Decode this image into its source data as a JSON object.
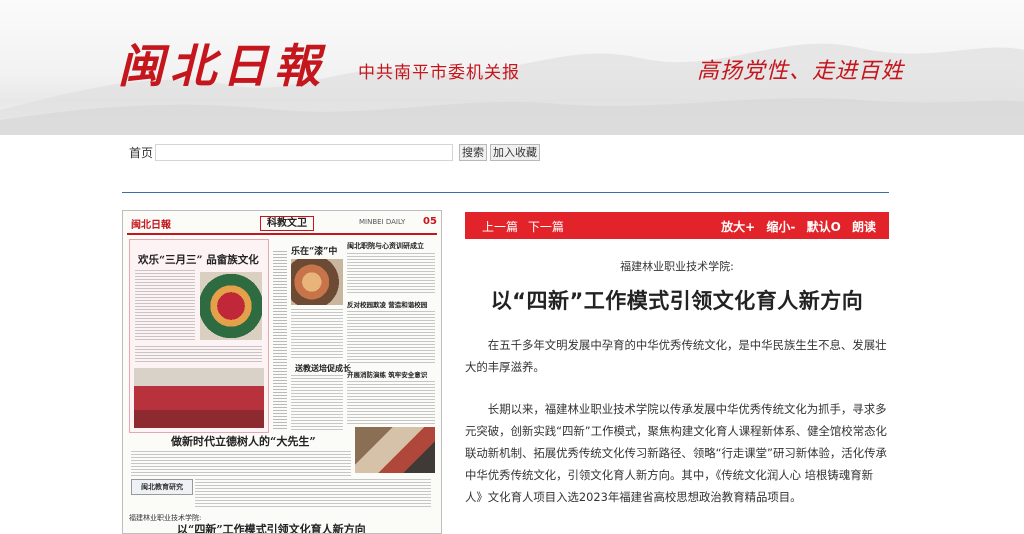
{
  "header": {
    "logo_text": "闽北日報",
    "subtitle": "中共南平市委机关报",
    "slogan": "高扬党性、走进百姓"
  },
  "search": {
    "home_label": "首页",
    "input_value": "",
    "search_button": "搜索",
    "favorite_button": "加入收藏"
  },
  "newspaper": {
    "masthead_logo": "闽北日報",
    "section": "科教文卫",
    "daily": "MINBEI DAILY",
    "page_no": "05",
    "headline_1": "欢乐“三月三” 品畲族文化",
    "headline_2": "乐在“漆”中",
    "headline_3": "闽北职院与心资训研成立",
    "headline_4": "反对校园欺凌 营造和谐校园",
    "headline_5": "送教送培促成长",
    "headline_6": "开展消防演练 筑牢安全意识",
    "headline_7": "做新时代立德树人的“大先生”",
    "column_logo": "闽北教育研究",
    "bottom_kicker": "福建林业职业技术学院:",
    "bottom_headline": "以“四新”工作模式引领文化育人新方向"
  },
  "toolbar": {
    "prev": "上一篇",
    "next": "下一篇",
    "zoom_in": "放大+",
    "zoom_out": "缩小-",
    "default": "默认O",
    "read_aloud": "朗读"
  },
  "article": {
    "kicker": "福建林业职业技术学院:",
    "title": "以“四新”工作模式引领文化育人新方向",
    "paragraph_1": "在五千多年文明发展中孕育的中华优秀传统文化，是中华民族生生不息、发展壮大的丰厚滋养。",
    "paragraph_2": "长期以来，福建林业职业技术学院以传承发展中华优秀传统文化为抓手，寻求多元突破，创新实践“四新”工作模式，聚焦构建文化育人课程新体系、健全馆校常态化联动新机制、拓展优秀传统文化传习新路径、领略“行走课堂”研习新体验，活化传承中华优秀传统文化，引领文化育人新方向。其中，《传统文化润人心 培根铸魂育新人》文化育人项目入选2023年福建省高校思想政治教育精品项目。"
  },
  "colors": {
    "brand_red": "#c4161c",
    "toolbar_red": "#e2232a",
    "divider_blue": "#3a6fa6"
  }
}
